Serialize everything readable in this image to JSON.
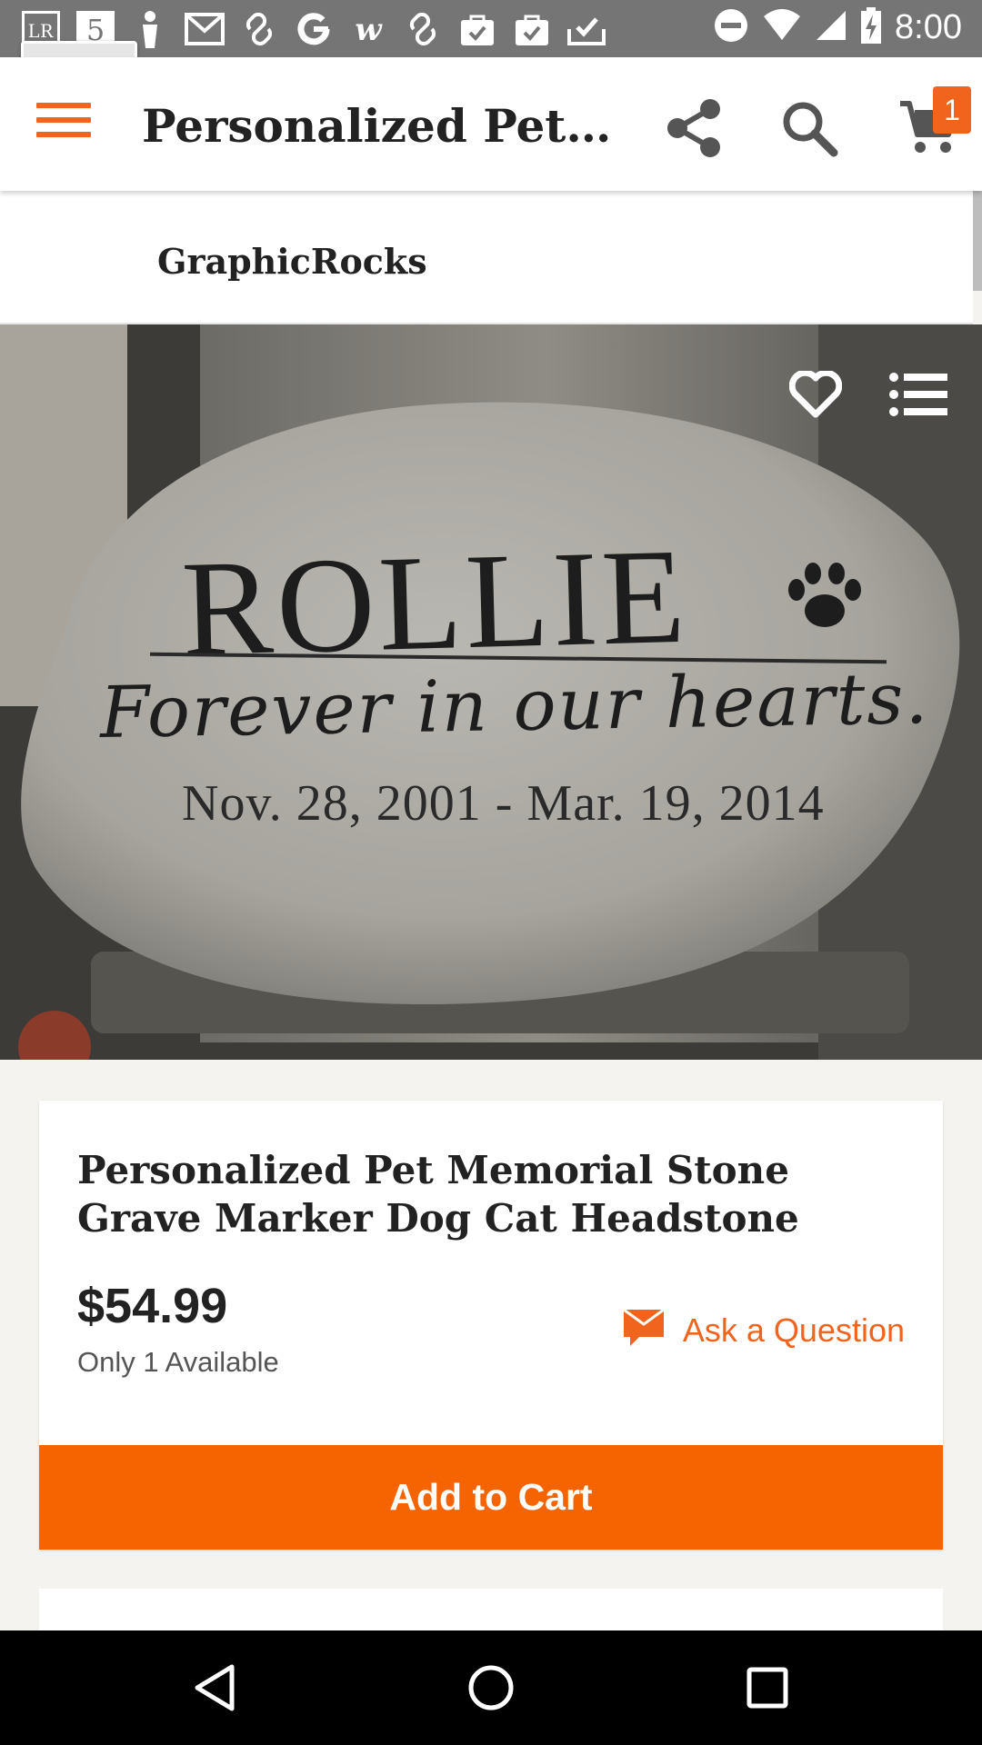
{
  "status_bar": {
    "time": "8:00",
    "notification_icons": [
      "lr-app-icon",
      "five-app-icon",
      "figure-icon",
      "gmail-icon",
      "link-icon",
      "google-icon",
      "w-app-icon",
      "link-icon",
      "shopping-bag-check-icon",
      "shopping-bag-check-icon",
      "tray-check-icon"
    ],
    "system_icons": [
      "do-not-disturb-icon",
      "wifi-icon",
      "signal-icon",
      "battery-charging-icon"
    ]
  },
  "app_bar": {
    "title": "Personalized Pet Me…",
    "cart_count": "1",
    "accent_color": "#f1641e"
  },
  "shop": {
    "name": "GraphicRocks"
  },
  "product_image": {
    "engraving": {
      "name": "ROLLIE",
      "phrase": "Forever in our hearts.",
      "dates": "Nov. 28, 2001 - Mar. 19, 2014"
    }
  },
  "product": {
    "title": "Personalized Pet Memorial Stone Grave Marker Dog Cat Headstone",
    "price": "$54.99",
    "availability": "Only 1 Available",
    "ask_question_label": "Ask a Question",
    "add_to_cart_label": "Add to Cart",
    "button_color": "#f56400"
  }
}
